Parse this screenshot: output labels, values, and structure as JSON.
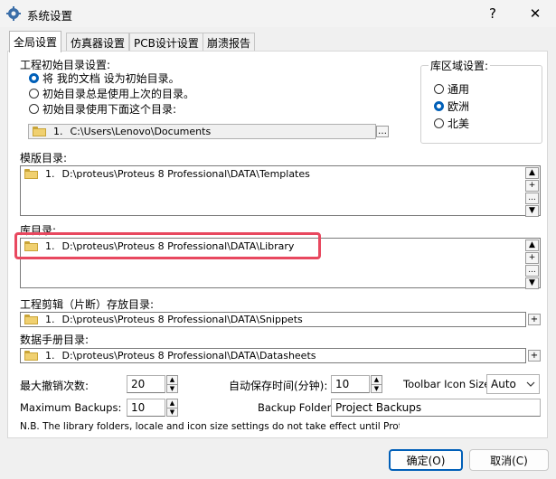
{
  "window": {
    "title": "系统设置",
    "help_label": "?",
    "close_label": "✕"
  },
  "tabs": [
    {
      "label": "全局设置"
    },
    {
      "label": "仿真器设置"
    },
    {
      "label": "PCB设计设置"
    },
    {
      "label": "崩溃报告"
    }
  ],
  "project_dir": {
    "label": "工程初始目录设置:",
    "options": [
      {
        "label": "将 我的文档 设为初始目录。",
        "selected": true
      },
      {
        "label": "初始目录总是使用上次的目录。",
        "selected": false
      },
      {
        "label": "初始目录使用下面这个目录:",
        "selected": false
      }
    ],
    "path": {
      "index": "1.",
      "value": "C:\\Users\\Lenovo\\Documents"
    }
  },
  "locale": {
    "label": "库区域设置:",
    "options": [
      {
        "label": "通用",
        "selected": false
      },
      {
        "label": "欧洲",
        "selected": true
      },
      {
        "label": "北美",
        "selected": false
      }
    ]
  },
  "templates": {
    "label": "模版目录:",
    "index": "1.",
    "path": "D:\\proteus\\Proteus 8 Professional\\DATA\\Templates"
  },
  "library": {
    "label": "库目录:",
    "index": "1.",
    "path": "D:\\proteus\\Proteus 8 Professional\\DATA\\Library"
  },
  "snippets": {
    "label": "工程剪辑（片断）存放目录:",
    "index": "1.",
    "path": "D:\\proteus\\Proteus 8 Professional\\DATA\\Snippets"
  },
  "datasheets": {
    "label": "数据手册目录:",
    "index": "1.",
    "path": "D:\\proteus\\Proteus 8 Professional\\DATA\\Datasheets"
  },
  "button_symbols": {
    "up": "▲",
    "add": "+",
    "more": "...",
    "down": "▼",
    "browse": "…"
  },
  "settings": {
    "max_undo_label": "最大撤销次数:",
    "max_undo_value": "20",
    "autosave_label": "自动保存时间(分钟):",
    "autosave_value": "10",
    "toolbar_icon_label": "Toolbar Icon Size:",
    "toolbar_icon_value": "Auto",
    "max_backups_label": "Maximum Backups:",
    "max_backups_value": "10",
    "backup_folder_label": "Backup Folder:",
    "backup_folder_value": "Project Backups"
  },
  "note": "N.B. The library folders, locale and icon size settings do not take effect until Proteus is res",
  "footer": {
    "ok_label": "确定(O)",
    "cancel_label": "取消(C)"
  },
  "accent_color": "#005fb8",
  "highlight_color": "#e8485f"
}
